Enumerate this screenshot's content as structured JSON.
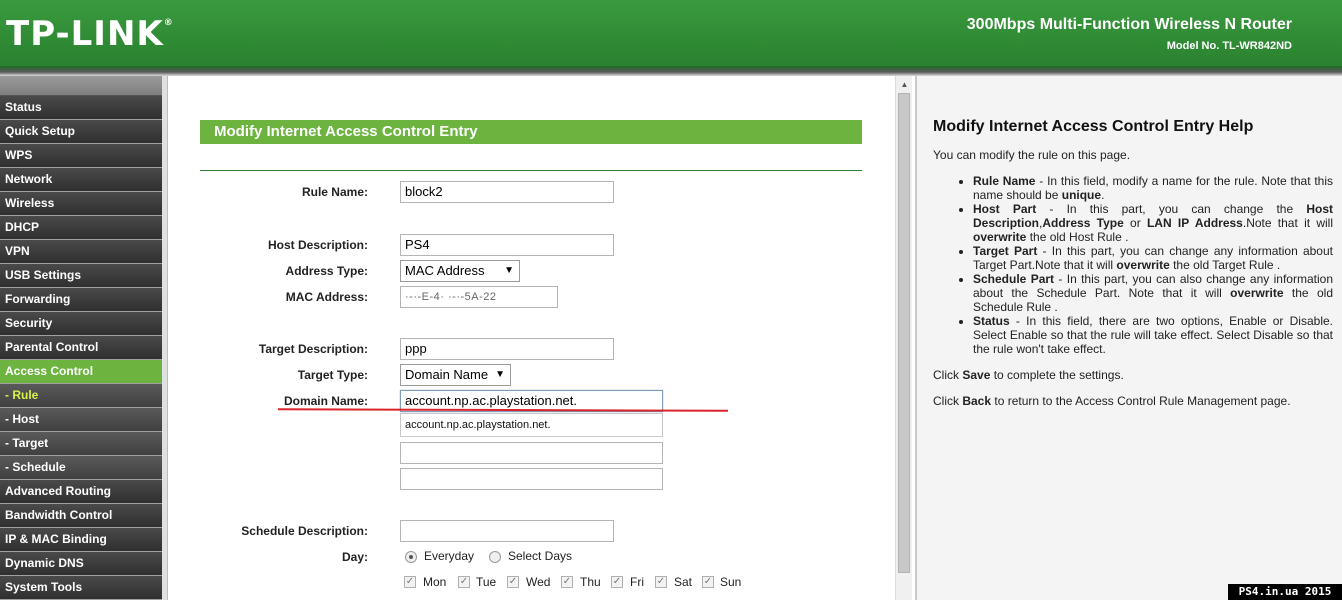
{
  "header": {
    "logo": "TP-LINK",
    "logo_mark": "®",
    "product": "300Mbps Multi-Function Wireless N Router",
    "model": "Model No. TL-WR842ND"
  },
  "sidebar": {
    "items": [
      {
        "label": "Status"
      },
      {
        "label": "Quick Setup"
      },
      {
        "label": "WPS"
      },
      {
        "label": "Network"
      },
      {
        "label": "Wireless"
      },
      {
        "label": "DHCP"
      },
      {
        "label": "VPN"
      },
      {
        "label": "USB Settings"
      },
      {
        "label": "Forwarding"
      },
      {
        "label": "Security"
      },
      {
        "label": "Parental Control"
      },
      {
        "label": "Access Control"
      },
      {
        "label": "- Rule"
      },
      {
        "label": "- Host"
      },
      {
        "label": "- Target"
      },
      {
        "label": "- Schedule"
      },
      {
        "label": "Advanced Routing"
      },
      {
        "label": "Bandwidth Control"
      },
      {
        "label": "IP & MAC Binding"
      },
      {
        "label": "Dynamic DNS"
      },
      {
        "label": "System Tools"
      }
    ]
  },
  "form": {
    "title": "Modify Internet Access Control Entry",
    "rule_name_label": "Rule Name:",
    "rule_name_value": "block2",
    "host_description_label": "Host Description:",
    "host_description_value": "PS4",
    "address_type_label": "Address Type:",
    "address_type_value": "MAC Address",
    "mac_address_label": "MAC Address:",
    "mac_address_value": "·-·-E-4·  ·-·-5A-22",
    "target_description_label": "Target Description:",
    "target_description_value": "ppp",
    "target_type_label": "Target Type:",
    "target_type_value": "Domain Name",
    "domain_name_label": "Domain Name:",
    "domain_name_value": "account.np.ac.playstation.net.",
    "domain_suggestion": "account.np.ac.playstation.net.",
    "schedule_description_label": "Schedule Description:",
    "schedule_description_value": "",
    "day_label": "Day:",
    "everyday_label": "Everyday",
    "select_days_label": "Select Days",
    "days": [
      "Mon",
      "Tue",
      "Wed",
      "Thu",
      "Fri",
      "Sat",
      "Sun"
    ]
  },
  "help": {
    "title": "Modify Internet Access Control Entry Help",
    "intro": "You can modify the rule on this page.",
    "items": [
      {
        "term": "Rule Name",
        "text": " - In this field, modify a name for the rule. Note that this name should be ",
        "strong": "unique",
        "tail": "."
      },
      {
        "term": "Host Part",
        "text": " - In this part, you can change the ",
        "strong": "Host Description",
        "mid": ",",
        "strong2": "Address Type",
        "mid2": " or ",
        "strong3": "LAN IP Address",
        "tail": ".Note that it will ",
        "strong4": "overwrite",
        "tail2": " the old Host Rule ."
      },
      {
        "term": "Target Part",
        "text": " - In this part, you can change any information about Target Part.Note that it will ",
        "strong": "overwrite",
        "tail": " the old Target Rule ."
      },
      {
        "term": "Schedule Part",
        "text": " - In this part, you can also change any information about the Schedule Part. Note that it will ",
        "strong": "overwrite",
        "tail": " the old Schedule Rule ."
      },
      {
        "term": "Status",
        "text": " - In this field, there are two options, Enable or Disable. Select Enable so that the rule will take effect. Select Disable so that the rule won't take effect."
      }
    ],
    "save_pre": "Click ",
    "save_word": "Save",
    "save_post": " to complete the settings.",
    "back_pre": "Click ",
    "back_word": "Back",
    "back_post": " to return to the Access Control Rule Management page."
  },
  "watermark": "PS4.in.ua  2015",
  "colors": {
    "brand_green": "#6cb33f",
    "header_green": "#2f8a34",
    "nav_dark": "#333333",
    "annotation_red": "#d9242b"
  }
}
